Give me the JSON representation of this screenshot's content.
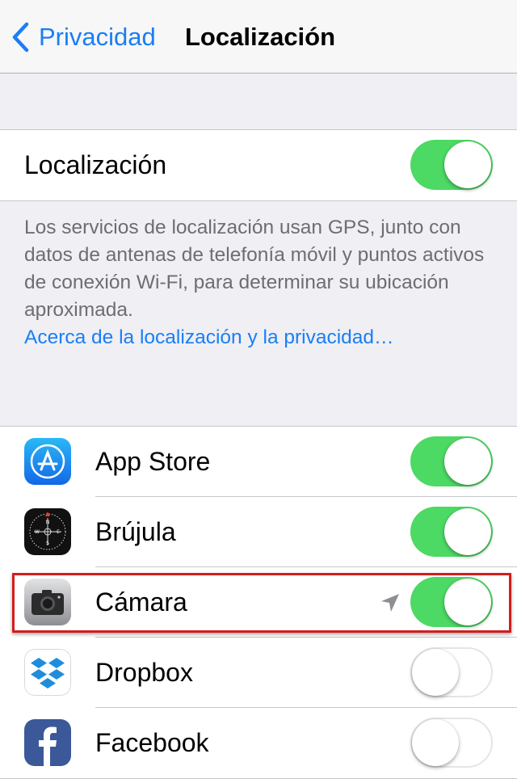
{
  "nav": {
    "back_label": "Privacidad",
    "title": "Localización"
  },
  "location_services": {
    "label": "Localización",
    "enabled": true
  },
  "footer": {
    "description": "Los servicios de localización usan GPS, junto con datos de antenas de telefonía móvil y puntos activos de conexión Wi-Fi, para determinar su ubicación aproximada.",
    "link": "Acerca de la localización y la privacidad…"
  },
  "apps": [
    {
      "name": "App Store",
      "icon": "app-store-icon",
      "enabled": true
    },
    {
      "name": "Brújula",
      "icon": "compass-icon",
      "enabled": true
    },
    {
      "name": "Cámara",
      "icon": "camera-icon",
      "enabled": true,
      "location_indicator": "location-arrow-icon"
    },
    {
      "name": "Dropbox",
      "icon": "dropbox-icon",
      "enabled": false
    },
    {
      "name": "Facebook",
      "icon": "facebook-icon",
      "enabled": false
    }
  ],
  "colors": {
    "accent": "#1a7ef5",
    "toggle_on": "#4cd964",
    "highlight": "#d21d1d"
  }
}
